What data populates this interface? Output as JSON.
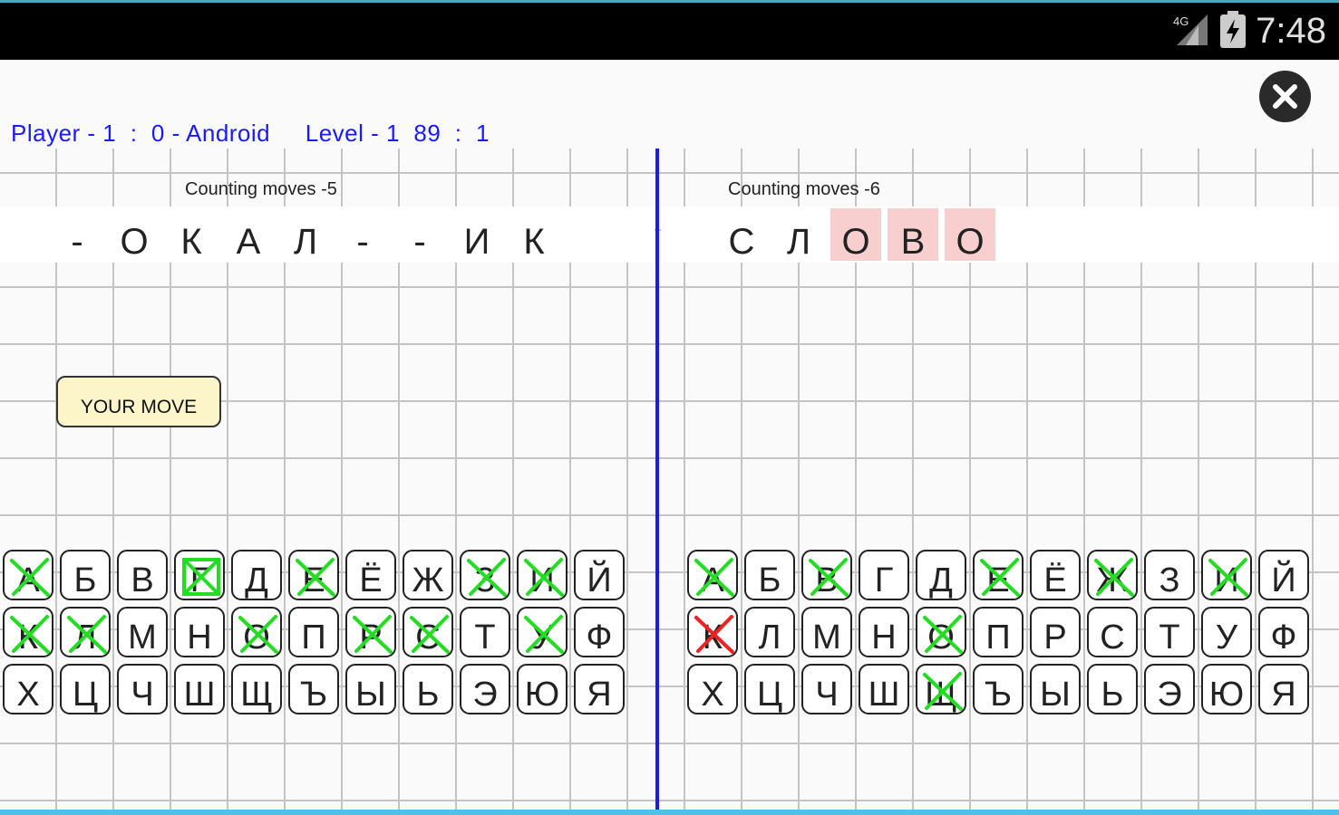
{
  "status_bar": {
    "time": "7:48",
    "network": "4G",
    "accent_color": "#4fa3c7"
  },
  "scoreline": {
    "text": "Player - 1  :  0 - Android     Level - 1  89  :  1",
    "color": "#1a1aff"
  },
  "left_panel": {
    "counting_label": "Counting moves -5",
    "word": [
      "-",
      "О",
      "К",
      "А",
      "Л",
      "-",
      "-",
      "И",
      "К"
    ]
  },
  "right_panel": {
    "counting_label": "Counting moves -6",
    "word": [
      "С",
      "Л",
      "О",
      "В",
      "О"
    ],
    "highlighted": [
      2,
      3,
      4
    ]
  },
  "your_move_label": "YOUR MOVE",
  "mark_colors": {
    "green": "#22dd22",
    "red": "#ee2222"
  },
  "left_keyboard": [
    [
      "А",
      "Б",
      "В",
      "Г",
      "Д",
      "Е",
      "Ё",
      "Ж",
      "З",
      "И",
      "Й"
    ],
    [
      "К",
      "Л",
      "М",
      "Н",
      "О",
      "П",
      "Р",
      "С",
      "Т",
      "У",
      "Ф"
    ],
    [
      "Х",
      "Ц",
      "Ч",
      "Ш",
      "Щ",
      "Ъ",
      "Ы",
      "Ь",
      "Э",
      "Ю",
      "Я"
    ]
  ],
  "left_marks": [
    [
      "x",
      "",
      "",
      "box",
      "",
      "x",
      "",
      "",
      "x",
      "x",
      ""
    ],
    [
      "x",
      "x",
      "",
      "",
      "x",
      "",
      "x",
      "x",
      "",
      "x",
      ""
    ],
    [
      "",
      "",
      "",
      "",
      "",
      "",
      "",
      "",
      "",
      "",
      ""
    ]
  ],
  "right_keyboard": [
    [
      "А",
      "Б",
      "В",
      "Г",
      "Д",
      "Е",
      "Ё",
      "Ж",
      "З",
      "И",
      "Й"
    ],
    [
      "К",
      "Л",
      "М",
      "Н",
      "О",
      "П",
      "Р",
      "С",
      "Т",
      "У",
      "Ф"
    ],
    [
      "Х",
      "Ц",
      "Ч",
      "Ш",
      "Щ",
      "Ъ",
      "Ы",
      "Ь",
      "Э",
      "Ю",
      "Я"
    ]
  ],
  "right_marks": [
    [
      "x",
      "",
      "x",
      "",
      "",
      "x",
      "",
      "x",
      "",
      "x",
      ""
    ],
    [
      "r",
      "",
      "",
      "",
      "x",
      "",
      "",
      "",
      "",
      "",
      ""
    ],
    [
      "",
      "",
      "",
      "",
      "x",
      "",
      "",
      "",
      "",
      "",
      ""
    ]
  ]
}
